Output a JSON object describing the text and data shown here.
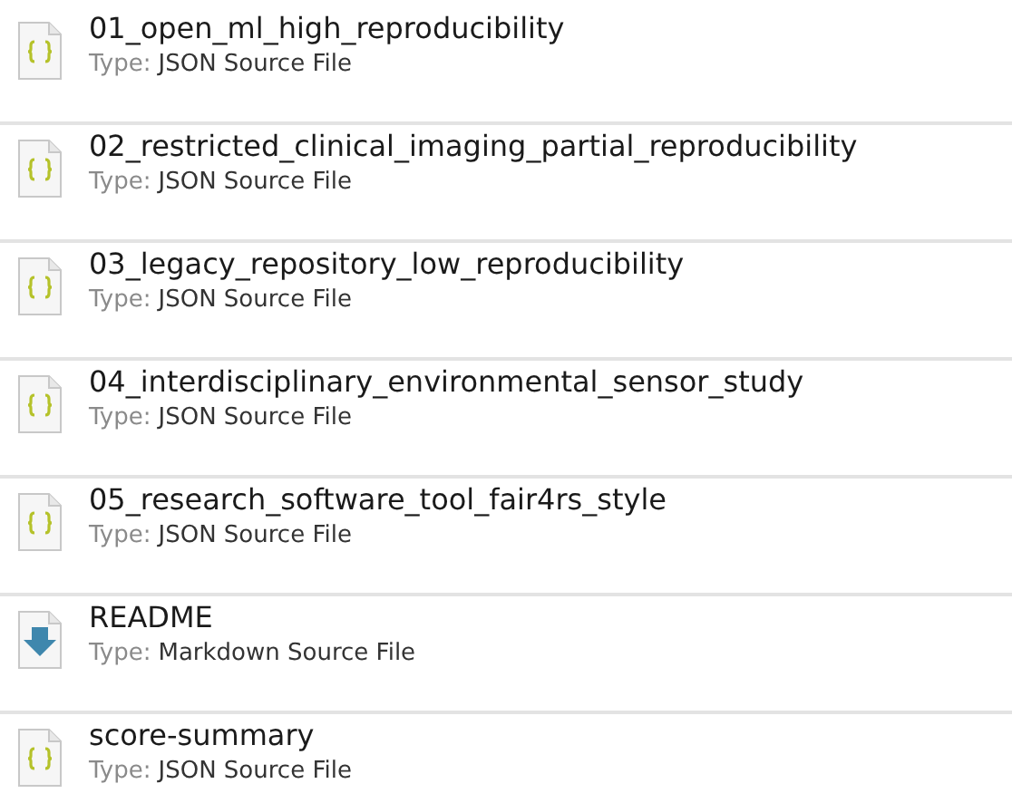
{
  "files": [
    {
      "name": "01_open_ml_high_reproducibility",
      "type_label": "Type:",
      "type": "JSON Source File",
      "kind": "json"
    },
    {
      "name": "02_restricted_clinical_imaging_partial_reproducibility",
      "type_label": "Type:",
      "type": "JSON Source File",
      "kind": "json"
    },
    {
      "name": "03_legacy_repository_low_reproducibility",
      "type_label": "Type:",
      "type": "JSON Source File",
      "kind": "json"
    },
    {
      "name": "04_interdisciplinary_environmental_sensor_study",
      "type_label": "Type:",
      "type": "JSON Source File",
      "kind": "json"
    },
    {
      "name": "05_research_software_tool_fair4rs_style",
      "type_label": "Type:",
      "type": "JSON Source File",
      "kind": "json"
    },
    {
      "name": "README",
      "type_label": "Type:",
      "type": "Markdown Source File",
      "kind": "markdown"
    },
    {
      "name": "score-summary",
      "type_label": "Type:",
      "type": "JSON Source File",
      "kind": "json"
    }
  ]
}
